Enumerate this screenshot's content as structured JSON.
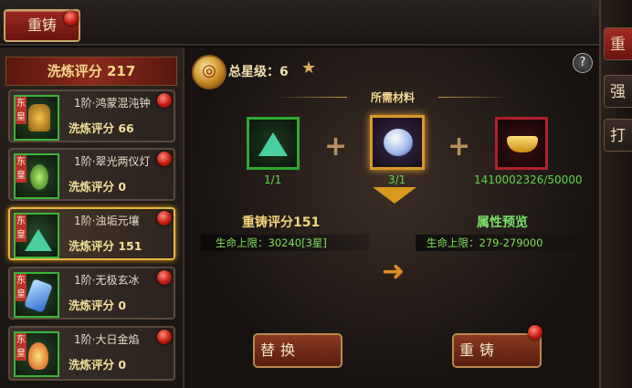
{
  "top_tab": {
    "label": "重铸"
  },
  "side_tabs": [
    "重铸",
    "强化",
    "打造"
  ],
  "left": {
    "title": "洗炼评分 217",
    "items": [
      {
        "name": "1阶·鸿蒙混沌钟",
        "score": "洗炼评分 66",
        "tag": "东皇",
        "selected": false
      },
      {
        "name": "1阶·翠光两仪灯",
        "score": "洗炼评分 0",
        "tag": "东皇",
        "selected": false
      },
      {
        "name": "1阶·浊垢元壤",
        "score": "洗炼评分 151",
        "tag": "东皇",
        "selected": true
      },
      {
        "name": "1阶·无极玄冰",
        "score": "洗炼评分 0",
        "tag": "东皇",
        "selected": false
      },
      {
        "name": "1阶·大日金焰",
        "score": "洗炼评分 0",
        "tag": "东皇",
        "selected": false
      }
    ]
  },
  "center": {
    "total_star_label": "总星级：6",
    "help_label": "?",
    "materials_title": "所需材料",
    "materials": [
      {
        "count": "1/1"
      },
      {
        "count": "3/1"
      },
      {
        "count": "1410002326/50000"
      }
    ],
    "recast_score": "重铸评分151",
    "preview_label": "属性预览",
    "current_attr": "生命上限：30240[3星]",
    "preview_attr": "生命上限：279-279000",
    "replace_button": "替换",
    "recast_button": "重铸"
  },
  "colors": {
    "accent_red": "#8a2a1c",
    "gold": "#f1d57a",
    "green": "#7ee05a"
  }
}
